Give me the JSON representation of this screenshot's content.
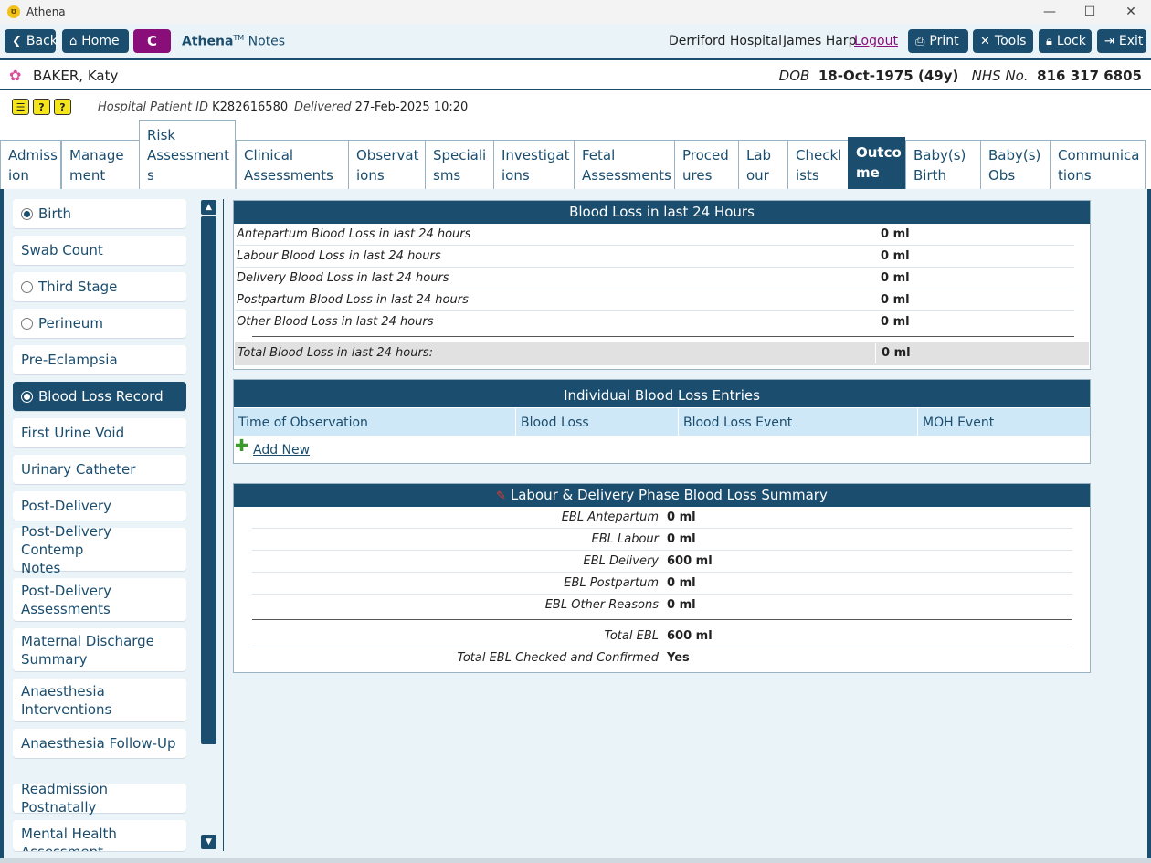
{
  "window": {
    "title": "Athena",
    "minimize_icon": "—",
    "maximize_icon": "☐",
    "close_icon": "✕"
  },
  "toolbar": {
    "back": "Back",
    "home": "Home",
    "c_button": "C",
    "brand_name": "Athena",
    "brand_tm": "TM",
    "brand_suffix": " Notes",
    "hospital": "Derriford Hospital",
    "user": "James Harp",
    "logout": "Logout",
    "print": "Print",
    "tools": "Tools",
    "lock": "Lock",
    "exit": "Exit"
  },
  "patient": {
    "name": "BAKER, Katy",
    "dob_label": "DOB",
    "dob": "18-Oct-1975 (49y)",
    "nhs_label": "NHS No.",
    "nhs": "816 317 6805"
  },
  "info": {
    "alerts": [
      "☰",
      "?",
      "?"
    ],
    "hospital_id_label": "Hospital Patient ID",
    "hospital_id": "K282616580",
    "delivered_label": "Delivered",
    "delivered": "27-Feb-2025 10:20"
  },
  "tabs": [
    {
      "l1": "Admiss",
      "l2": "ion"
    },
    {
      "l1": "Manage",
      "l2": "ment"
    },
    {
      "l1": "Risk",
      "l2": "Assessment",
      "l3": "s"
    },
    {
      "l1": "Clinical",
      "l2": "Assessments"
    },
    {
      "l1": "Observat",
      "l2": "ions"
    },
    {
      "l1": "Speciali",
      "l2": "sms"
    },
    {
      "l1": "Investigat",
      "l2": "ions"
    },
    {
      "l1": "Fetal",
      "l2": "Assessments"
    },
    {
      "l1": "Proced",
      "l2": "ures"
    },
    {
      "l1": "Lab",
      "l2": "our"
    },
    {
      "l1": "Checkl",
      "l2": "ists"
    },
    {
      "l1": "Outco",
      "l2": "me"
    },
    {
      "l1": "Baby(s)",
      "l2": "Birth"
    },
    {
      "l1": "Baby(s)",
      "l2": "Obs"
    },
    {
      "l1": "Communica",
      "l2": "tions"
    }
  ],
  "sidebar": [
    {
      "label": "Birth"
    },
    {
      "label": "Swab Count"
    },
    {
      "label": "Third Stage"
    },
    {
      "label": "Perineum"
    },
    {
      "label": "Pre-Eclampsia"
    },
    {
      "label": "Blood Loss Record"
    },
    {
      "label": "First Urine Void"
    },
    {
      "label": "Urinary Catheter"
    },
    {
      "label": "Post-Delivery"
    },
    {
      "l1": "Post-Delivery Contemp",
      "l2": "Notes"
    },
    {
      "l1": "Post-Delivery",
      "l2": "Assessments"
    },
    {
      "l1": "Maternal Discharge",
      "l2": "Summary"
    },
    {
      "l1": "Anaesthesia",
      "l2": "Interventions"
    },
    {
      "label": "Anaesthesia Follow-Up"
    },
    {
      "label": "Readmission Postnatally"
    },
    {
      "l1": "Mental Health",
      "l2": "Assessment"
    }
  ],
  "blood_loss_24h": {
    "title": "Blood Loss in last 24 Hours",
    "rows": [
      {
        "label": "Antepartum Blood Loss in last 24 hours",
        "value": "0 ml"
      },
      {
        "label": "Labour Blood Loss in last 24 hours",
        "value": "0 ml"
      },
      {
        "label": "Delivery Blood Loss in last 24 hours",
        "value": "0 ml"
      },
      {
        "label": "Postpartum Blood Loss in last 24 hours",
        "value": "0 ml"
      },
      {
        "label": "Other Blood Loss in last 24 hours",
        "value": "0 ml"
      }
    ],
    "total_label": "Total Blood Loss in last 24 hours:",
    "total_value": "0 ml"
  },
  "entries": {
    "title": "Individual Blood Loss Entries",
    "columns": [
      "Time of Observation",
      "Blood Loss",
      "Blood Loss Event",
      "MOH Event"
    ],
    "add_new": "Add New"
  },
  "summary": {
    "title": "Labour & Delivery Phase Blood Loss Summary",
    "rows": [
      {
        "label": "EBL Antepartum",
        "value": "0 ml"
      },
      {
        "label": "EBL Labour",
        "value": "0 ml"
      },
      {
        "label": "EBL Delivery",
        "value": "600 ml"
      },
      {
        "label": "EBL Postpartum",
        "value": "0 ml"
      },
      {
        "label": "EBL Other Reasons",
        "value": "0 ml"
      }
    ],
    "totals": [
      {
        "label": "Total EBL",
        "value": "600 ml"
      },
      {
        "label": "Total EBL Checked and Confirmed",
        "value": "Yes"
      }
    ]
  }
}
